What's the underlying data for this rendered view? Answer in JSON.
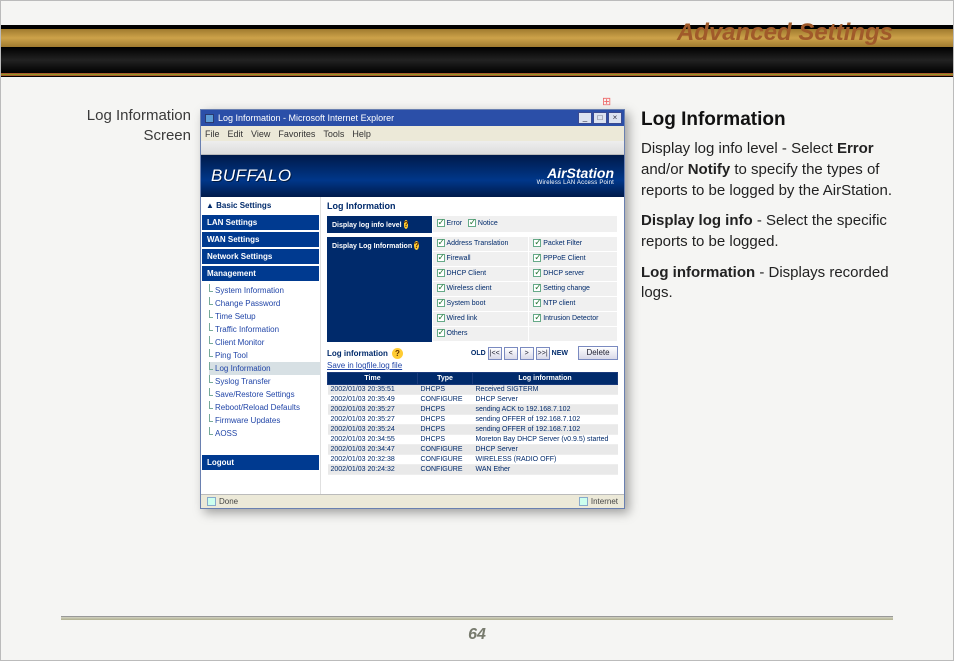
{
  "header": {
    "title": "Advanced Settings"
  },
  "caption": "Log Information Screen",
  "window": {
    "title": "Log Information - Microsoft Internet Explorer",
    "menu": [
      "File",
      "Edit",
      "View",
      "Favorites",
      "Tools",
      "Help"
    ],
    "status_left": "Done",
    "status_right": "Internet"
  },
  "hero": {
    "logo": "BUFFALO",
    "product": "AirStation",
    "tagline": "Wireless LAN Access Point"
  },
  "sidebar": {
    "basic": "Basic Settings",
    "lan": "LAN Settings",
    "wan": "WAN Settings",
    "network": "Network Settings",
    "management": "Management",
    "items": [
      "System Information",
      "Change Password",
      "Time Setup",
      "Traffic Information",
      "Client Monitor",
      "Ping Tool",
      "Log Information",
      "Syslog Transfer",
      "Save/Restore Settings",
      "Reboot/Reload Defaults",
      "Firmware Updates",
      "AOSS"
    ],
    "logout": "Logout"
  },
  "main": {
    "heading": "Log Information",
    "row1_label": "Display log info level",
    "row1_opts": [
      "Error",
      "Notice"
    ],
    "row2_label": "Display Log Information",
    "row2_opts": [
      [
        "Address Translation",
        "Packet Filter"
      ],
      [
        "Firewall",
        "PPPoE Client"
      ],
      [
        "DHCP Client",
        "DHCP server"
      ],
      [
        "Wireless client",
        "Setting change"
      ],
      [
        "System boot",
        "NTP client"
      ],
      [
        "Wired link",
        "Intrusion Detector"
      ],
      [
        "Others",
        ""
      ]
    ],
    "log_label": "Log information",
    "save_link": "Save in logfile.log file",
    "pager": {
      "old": "OLD",
      "new": "NEW",
      "first": "|<<",
      "prev": "<",
      "next": ">",
      "last": ">>|"
    },
    "delete_btn": "Delete",
    "table_headers": [
      "Time",
      "Type",
      "Log information"
    ],
    "rows": [
      [
        "2002/01/03 20:35:51",
        "DHCPS",
        "Received SIGTERM"
      ],
      [
        "2002/01/03 20:35:49",
        "CONFIGURE",
        "DHCP Server"
      ],
      [
        "2002/01/03 20:35:27",
        "DHCPS",
        "sending ACK to 192.168.7.102"
      ],
      [
        "2002/01/03 20:35:27",
        "DHCPS",
        "sending OFFER of 192.168.7.102"
      ],
      [
        "2002/01/03 20:35:24",
        "DHCPS",
        "sending OFFER of 192.168.7.102"
      ],
      [
        "2002/01/03 20:34:55",
        "DHCPS",
        "Moreton Bay DHCP Server (v0.9.5) started"
      ],
      [
        "2002/01/03 20:34:47",
        "CONFIGURE",
        "DHCP Server"
      ],
      [
        "2002/01/03 20:32:38",
        "CONFIGURE",
        "WIRELESS (RADIO OFF)"
      ],
      [
        "2002/01/03 20:24:32",
        "CONFIGURE",
        "WAN Ether"
      ]
    ]
  },
  "doc": {
    "h": "Log Information",
    "p1a": "Display log info level - Select ",
    "p1b": "Error",
    "p1c": " and/or ",
    "p1d": "Notify",
    "p1e": " to specify the types of reports to be logged by the AirStation.",
    "p2a": "Display log info",
    "p2b": " - Select the specific reports to be logged.",
    "p3a": "Log information",
    "p3b": " - Displays recorded logs."
  },
  "footer": {
    "page": "64"
  }
}
